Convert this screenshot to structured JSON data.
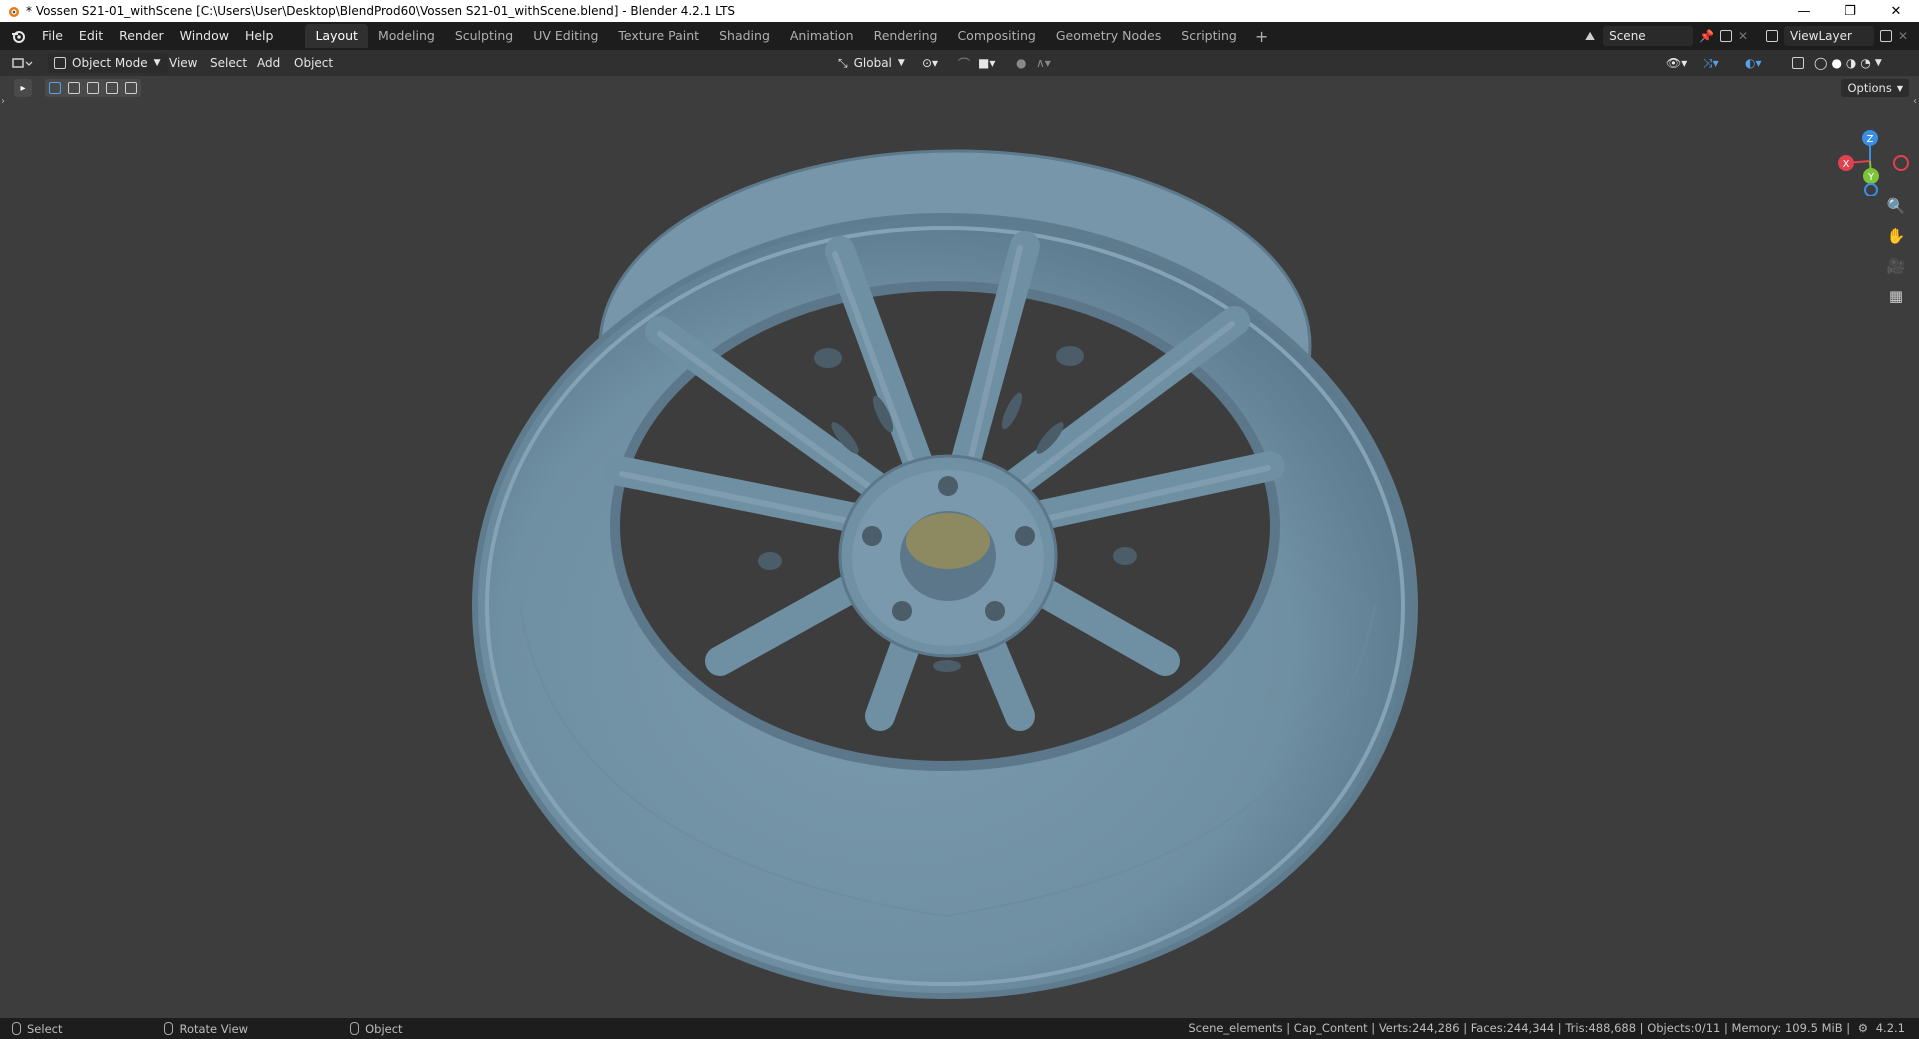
{
  "window": {
    "title": "* Vossen S21-01_withScene [C:\\Users\\User\\Desktop\\BlendProd60\\Vossen S21-01_withScene.blend] - Blender 4.2.1 LTS",
    "minimize": "—",
    "maximize": "❐",
    "close": "✕"
  },
  "menu": [
    "File",
    "Edit",
    "Render",
    "Window",
    "Help"
  ],
  "workspaces": [
    "Layout",
    "Modeling",
    "Sculpting",
    "UV Editing",
    "Texture Paint",
    "Shading",
    "Animation",
    "Rendering",
    "Compositing",
    "Geometry Nodes",
    "Scripting"
  ],
  "workspace_add": "+",
  "scene": {
    "label": "Scene"
  },
  "view_layer": {
    "label": "ViewLayer"
  },
  "header": {
    "mode": "Object Mode",
    "view": "View",
    "select": "Select",
    "add": "Add",
    "object": "Object",
    "orientation": "Global",
    "options": "Options"
  },
  "gizmo": {
    "x": "X",
    "y": "Y",
    "z": "Z"
  },
  "status": {
    "select": "Select",
    "rotate": "Rotate View",
    "object": "Object",
    "stats": "Scene_elements | Cap_Content | Verts:244,286 | Faces:244,344 | Tris:488,688 | Objects:0/11 | Memory: 109.5 MiB |",
    "version": "4.2.1"
  },
  "colors": {
    "wheel": "#6f8fa2",
    "hub_cap": "#8d8a62",
    "background": "#3d3d3d",
    "accent_x": "#e0414f",
    "accent_y": "#7ec43b",
    "accent_z": "#3a8ee3"
  }
}
